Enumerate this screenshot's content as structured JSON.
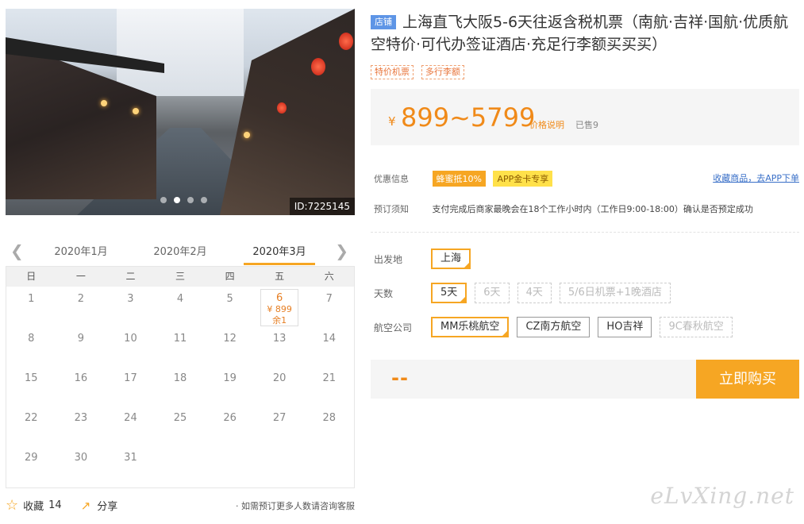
{
  "hero": {
    "id_label": "ID:7225145",
    "dots": 4,
    "active_dot": 1
  },
  "calendar": {
    "months": [
      "2020年1月",
      "2020年2月",
      "2020年3月"
    ],
    "active_month": 2,
    "weekdays": [
      "日",
      "一",
      "二",
      "三",
      "四",
      "五",
      "六"
    ],
    "rows": [
      [
        "1",
        "2",
        "3",
        "4",
        "5",
        "6",
        "7"
      ],
      [
        "8",
        "9",
        "10",
        "11",
        "12",
        "13",
        "14"
      ],
      [
        "15",
        "16",
        "17",
        "18",
        "19",
        "20",
        "21"
      ],
      [
        "22",
        "23",
        "24",
        "25",
        "26",
        "27",
        "28"
      ],
      [
        "29",
        "30",
        "31",
        "",
        "",
        "",
        ""
      ]
    ],
    "selected": {
      "day": "6",
      "price": "¥ 899",
      "remaining": "余1"
    }
  },
  "footer": {
    "favorite_label": "收藏",
    "favorite_count": "14",
    "share_label": "分享",
    "note": "· 如需预订更多人数请咨询客服"
  },
  "product": {
    "shop_badge": "店铺",
    "title": "上海直飞大阪5-6天往返含税机票（南航·吉祥·国航·优质航空特价·可代办签证酒店·充足行李额买买买）",
    "tags": [
      "特价机票",
      "多行李额"
    ]
  },
  "price": {
    "currency": "¥",
    "range": "899~5799",
    "explain": "价格说明",
    "sold": "已售9"
  },
  "info": {
    "promo_label": "优惠信息",
    "promo_1": "蜂蜜抵10%",
    "promo_2": "APP金卡专享",
    "collect_link": "收藏商品，去APP下单",
    "notice_label": "预订须知",
    "notice_text": "支付完成后商家最晚会在18个工作小时内（工作日9:00-18:00）确认是否预定成功"
  },
  "options": {
    "departure": {
      "label": "出发地",
      "items": [
        "上海"
      ]
    },
    "days": {
      "label": "天数",
      "items": [
        "5天",
        "6天",
        "4天",
        "5/6日机票+1晚酒店"
      ]
    },
    "airline": {
      "label": "航空公司",
      "items": [
        "MM乐桃航空",
        "CZ南方航空",
        "HO吉祥",
        "9C春秋航空"
      ]
    }
  },
  "buy": {
    "price_placeholder": "--",
    "button": "立即购买"
  },
  "watermark": "eLvXing.net"
}
